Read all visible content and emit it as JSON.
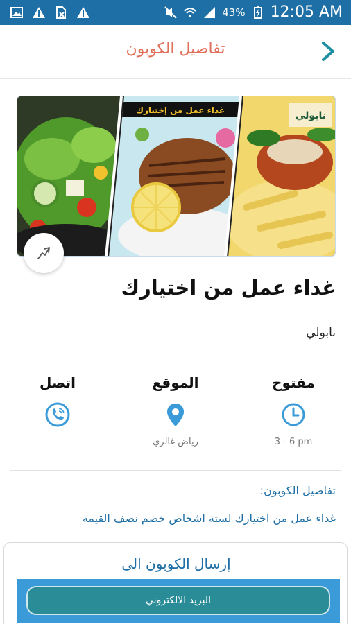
{
  "status_bar": {
    "battery_pct": "43%",
    "time": "12:05 AM"
  },
  "header": {
    "title": "تفاصيل الكوبون"
  },
  "banner": {
    "ribbon": "غداء عمل من إختيارك",
    "brand": "نابولي"
  },
  "offer": {
    "title": "غداء عمل من اختيارك",
    "vendor": "نابولي"
  },
  "info": {
    "open": {
      "label": "مفتوح",
      "sub": "3 - 6 pm",
      "icon": "clock-icon"
    },
    "location": {
      "label": "الموقع",
      "sub": "رياض غالري",
      "icon": "location-pin-icon"
    },
    "call": {
      "label": "اتصل",
      "icon": "phone-icon"
    }
  },
  "details": {
    "heading": "تفاصيل الكوبون:",
    "body": "غداء عمل من اختيارك لستة اشخاص خصم نصف القيمة"
  },
  "send": {
    "title": "إرسال الكوبون الى",
    "email_label": "البريد الالكتروني"
  },
  "colors": {
    "status_bar": "#1e6fa5",
    "header_title": "#e0705a",
    "accent_blue": "#1e6fa5",
    "email_button": "#2a8c97"
  }
}
